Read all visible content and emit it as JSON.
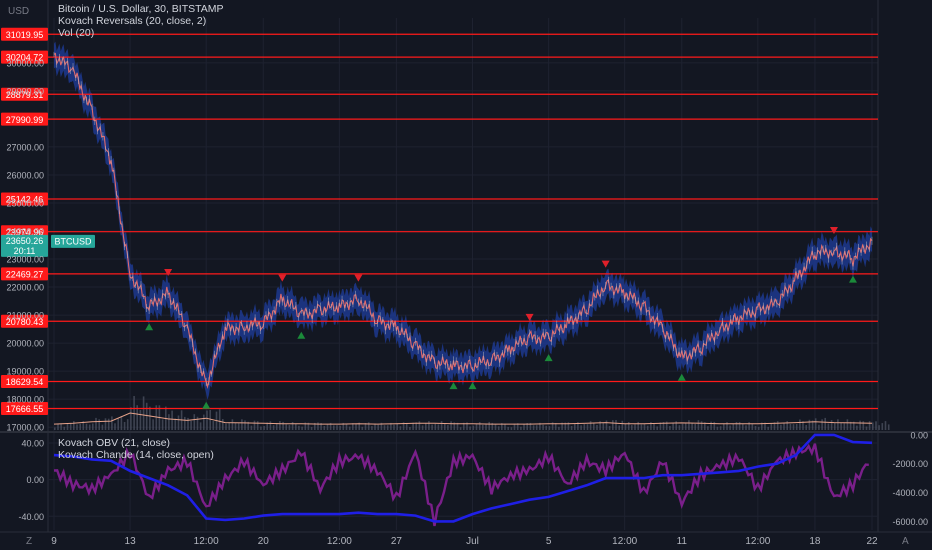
{
  "header": {
    "symbol_title": "Bitcoin / U.S. Dollar, 30, BITSTAMP",
    "indicator_1": "Kovach Reversals (20, close, 2)",
    "indicator_2": "Vol (20)",
    "currency": "USD"
  },
  "lower_pane": {
    "indicator_1": "Kovach OBV (21, close)",
    "indicator_2": "Kovach Chande (14, close, open)"
  },
  "controls": {
    "timezone_icon": "Z",
    "auto_scale_icon": "A"
  },
  "colors": {
    "background": "#131722",
    "level_line": "#ff1a1a",
    "up_arrow": "#1b8a3a",
    "down_arrow": "#e0202a",
    "price_line": "#e06a6a",
    "band": "#1f3d9e",
    "obv": "#1f1fe6",
    "chande": "#7a1f8a",
    "ticker_tag": "#26a69a"
  },
  "chart_data": [
    {
      "type": "line",
      "title": "Bitcoin / U.S. Dollar, 30, BITSTAMP",
      "y_unit": "USD",
      "ylim": [
        16900,
        31600
      ],
      "x_ticks": [
        "9",
        "13",
        "12:00",
        "20",
        "12:00",
        "27",
        "Jul",
        "5",
        "12:00",
        "11",
        "12:00",
        "18",
        "22"
      ],
      "y_ticks": [
        "30000.00",
        "29000.00",
        "27000.00",
        "26000.00",
        "25000.00",
        "24000.00",
        "23000.00",
        "22000.00",
        "21000.00",
        "20000.00",
        "19000.00",
        "18000.00",
        "17000.00"
      ],
      "level_lines": [
        "31019.95",
        "30204.72",
        "28879.31",
        "27990.99",
        "25142.46",
        "23974.96",
        "22469.27",
        "20780.43",
        "18629.54",
        "17666.55"
      ],
      "last_price": "23650.26",
      "countdown": "20:11",
      "ticker": "BTCUSD",
      "series": [
        {
          "name": "BTCUSD",
          "x": [
            "9",
            "10",
            "11",
            "12",
            "13",
            "14",
            "15",
            "16",
            "17",
            "18",
            "19",
            "20",
            "21",
            "22",
            "23",
            "24",
            "25",
            "26",
            "27",
            "28",
            "29",
            "30",
            "Jul",
            "2",
            "3",
            "4",
            "5",
            "6",
            "7",
            "8",
            "9",
            "10",
            "11",
            "12",
            "13",
            "14",
            "15",
            "16",
            "17",
            "18",
            "19",
            "20",
            "21",
            "22"
          ],
          "values": [
            30300,
            29700,
            28300,
            26500,
            22500,
            21300,
            21800,
            20500,
            18500,
            20500,
            20600,
            20700,
            21600,
            21000,
            21200,
            21300,
            21600,
            20800,
            20600,
            19900,
            19300,
            19200,
            19200,
            19400,
            19800,
            20200,
            20200,
            20700,
            21200,
            22100,
            21800,
            21300,
            20500,
            19500,
            19800,
            20500,
            20900,
            21200,
            21400,
            22300,
            23200,
            23300,
            23000,
            23650
          ]
        }
      ],
      "volume": [
        8,
        10,
        14,
        16,
        38,
        30,
        22,
        18,
        24,
        12,
        11,
        10,
        9,
        9,
        8,
        8,
        9,
        8,
        9,
        10,
        10,
        9,
        9,
        8,
        8,
        8,
        9,
        9,
        10,
        12,
        9,
        9,
        10,
        11,
        10,
        9,
        9,
        9,
        10,
        12,
        14,
        12,
        11,
        10
      ]
    },
    {
      "type": "line",
      "title": "",
      "ylim_left": [
        -55,
        52
      ],
      "y_ticks_left": [
        "40.00",
        "0.00",
        "-40.00"
      ],
      "ylim_right": [
        -6600,
        200
      ],
      "y_ticks_right": [
        "0.00",
        "-2000.00",
        "-4000.00",
        "-6000.00"
      ],
      "series": [
        {
          "name": "Kovach OBV (21, close)",
          "axis": "right",
          "values": [
            -1400,
            -1500,
            -1700,
            -1800,
            -2500,
            -3000,
            -3500,
            -4200,
            -5800,
            -5900,
            -5800,
            -5600,
            -5500,
            -5500,
            -5500,
            -5500,
            -5400,
            -5500,
            -5500,
            -5600,
            -6000,
            -6000,
            -5500,
            -5100,
            -4800,
            -4500,
            -4300,
            -3900,
            -3500,
            -3000,
            -3000,
            -3000,
            -2800,
            -2800,
            -2700,
            -2600,
            -2500,
            -2200,
            -2000,
            -1400,
            0,
            0,
            -500,
            -550
          ]
        },
        {
          "name": "Kovach Chande (14, close, open)",
          "axis": "left",
          "values": [
            10,
            -5,
            -10,
            5,
            30,
            -20,
            10,
            20,
            -30,
            0,
            20,
            -5,
            10,
            30,
            -10,
            20,
            25,
            10,
            -20,
            30,
            -45,
            20,
            25,
            -10,
            5,
            10,
            25,
            -5,
            20,
            10,
            30,
            -15,
            20,
            -25,
            5,
            15,
            25,
            -10,
            20,
            30,
            35,
            -20,
            -5,
            25
          ]
        }
      ]
    }
  ]
}
